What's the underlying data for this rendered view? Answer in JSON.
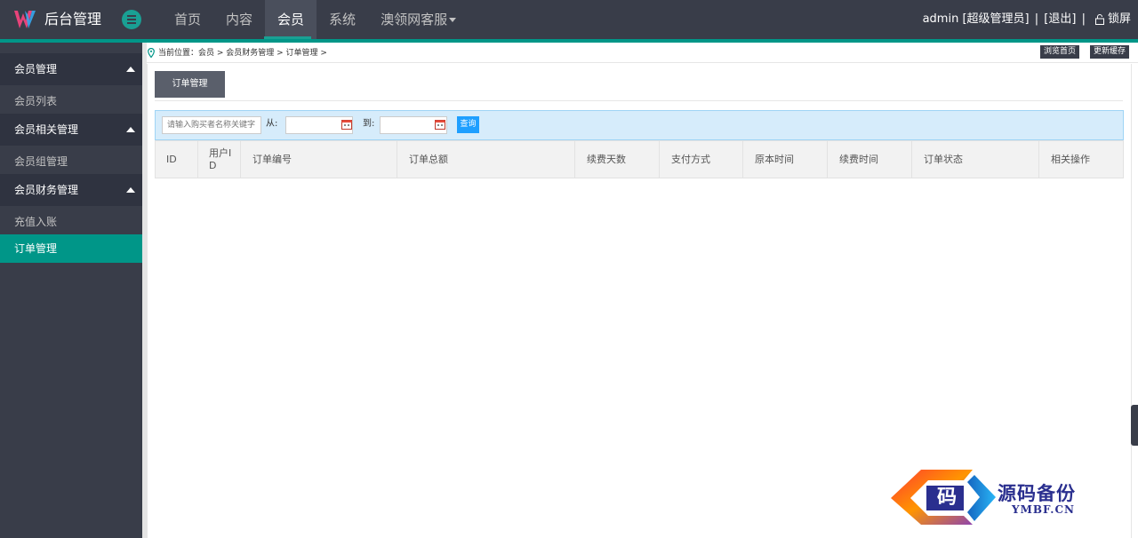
{
  "header": {
    "brand": "后台管理",
    "nav": [
      {
        "label": "首页"
      },
      {
        "label": "内容"
      },
      {
        "label": "会员"
      },
      {
        "label": "系统"
      },
      {
        "label": "澳领网客服"
      }
    ],
    "user": "admin",
    "role": "[超级管理员]",
    "logout": "[退出]",
    "separator": "|",
    "lock": "锁屏"
  },
  "sidebar": {
    "groups": [
      {
        "label": "会员管理",
        "items": [
          {
            "label": "会员列表"
          }
        ]
      },
      {
        "label": "会员相关管理",
        "items": [
          {
            "label": "会员组管理"
          }
        ]
      },
      {
        "label": "会员财务管理",
        "items": [
          {
            "label": "充值入账"
          },
          {
            "label": "订单管理"
          }
        ]
      }
    ]
  },
  "breadcrumb": {
    "text": "当前位置：会员 > 会员财务管理 > 订单管理 >",
    "browse_home": "浏览首页",
    "refresh_cache": "更新缓存"
  },
  "tab": {
    "label": "订单管理"
  },
  "filter": {
    "search_placeholder": "请输入购买者名称关键字",
    "from_label": "从:",
    "to_label": "到:",
    "query_label": "查询"
  },
  "table": {
    "columns": [
      "ID",
      "用户ID",
      "订单编号",
      "订单总额",
      "续费天数",
      "支付方式",
      "原本时间",
      "续费时间",
      "订单状态",
      "相关操作"
    ]
  },
  "watermark": {
    "char": "码",
    "title": "源码备份",
    "subtitle": "YMBF.CN"
  },
  "colors": {
    "topbar": "#393d49",
    "accent": "#009688",
    "query_button": "#1e9fff"
  }
}
